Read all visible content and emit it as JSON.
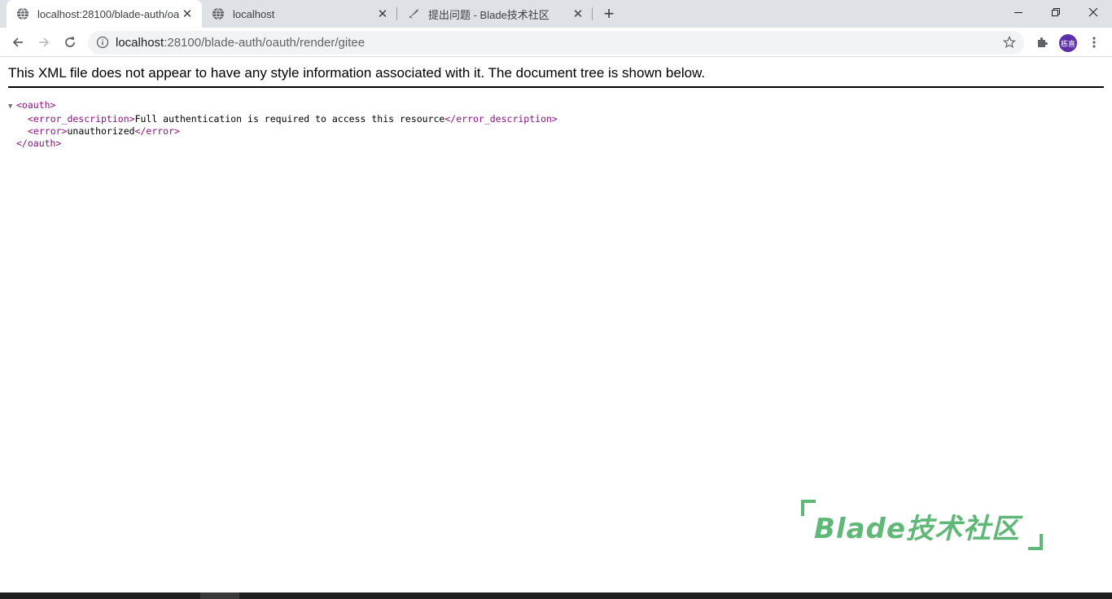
{
  "tabs": [
    {
      "title": "localhost:28100/blade-auth/oauth/render/gitee",
      "active": true,
      "favicon": "globe-icon"
    },
    {
      "title": "localhost",
      "active": false,
      "favicon": "globe-icon"
    },
    {
      "title": "提出问题 - Blade技术社区",
      "active": false,
      "favicon": "quill-icon"
    }
  ],
  "address_bar": {
    "host": "localhost",
    "path": ":28100/blade-auth/oauth/render/gitee"
  },
  "profile": {
    "initials": "栋喜"
  },
  "xml_notice": "This XML file does not appear to have any style information associated with it. The document tree is shown below.",
  "xml": {
    "root_open": "<oauth>",
    "desc_open": "<error_description>",
    "desc_value": "Full authentication is required to access this resource",
    "desc_close": "</error_description>",
    "error_open": "<error>",
    "error_value": "unauthorized",
    "error_close": "</error>",
    "root_close": "</oauth>"
  },
  "watermark": {
    "text": "Blade技术社区"
  },
  "colors": {
    "accent_green": "#5fb878",
    "xml_tag": "#881280",
    "avatar_bg": "#5b2fa8"
  }
}
